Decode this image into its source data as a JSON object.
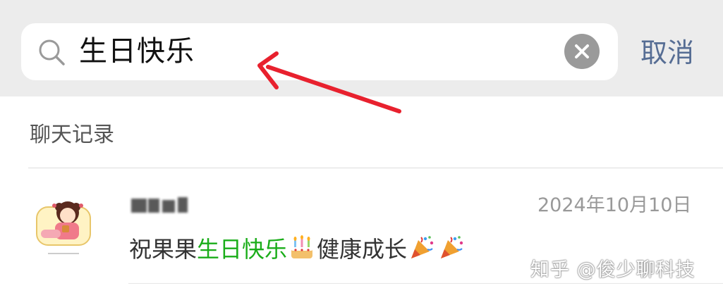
{
  "search": {
    "query": "生日快乐",
    "cancel_label": "取消"
  },
  "section": {
    "title": "聊天记录"
  },
  "result": {
    "date": "2024年10月10日",
    "message_prefix": "祝果果",
    "message_highlight": "生日快乐",
    "message_middle": "健康成长",
    "emojis": [
      "cake-icon",
      "party-popper-icon",
      "party-popper-icon"
    ]
  },
  "watermark": {
    "text": "知乎 @俊少聊科技"
  },
  "colors": {
    "highlight": "#1aad19",
    "cancel": "#566d94",
    "arrow": "#e8212e"
  }
}
